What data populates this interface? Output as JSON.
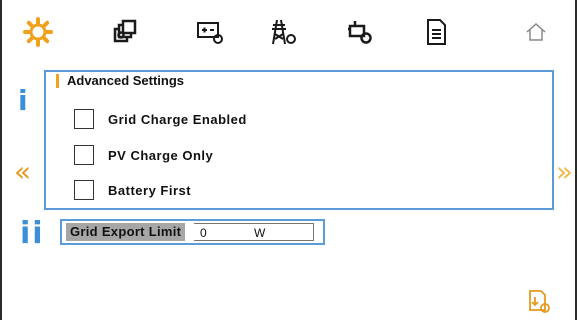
{
  "toolbar": {
    "icons": [
      "gear-icon",
      "multi-window-icon",
      "battery-settings-icon",
      "grid-tower-settings-icon",
      "generator-settings-icon",
      "document-icon",
      "home-icon"
    ],
    "colors": {
      "gear": "#f0a11e",
      "icon": "#1a1a1a",
      "home": "#888888"
    }
  },
  "nav": {
    "prev": "«",
    "next": "»"
  },
  "markers": {
    "section_i": "i",
    "section_ii": "ii"
  },
  "advanced": {
    "title": "Advanced Settings",
    "options": [
      {
        "label": "Grid Charge Enabled",
        "checked": false
      },
      {
        "label": "PV Charge Only",
        "checked": false
      },
      {
        "label": "Battery First",
        "checked": false
      }
    ]
  },
  "grid_export": {
    "label": "Grid Export Limit",
    "value": "0",
    "unit": "W"
  },
  "colors": {
    "accent_blue": "#5b9bd9",
    "marker_blue": "#3a8fd8",
    "orange": "#f0a11e"
  }
}
